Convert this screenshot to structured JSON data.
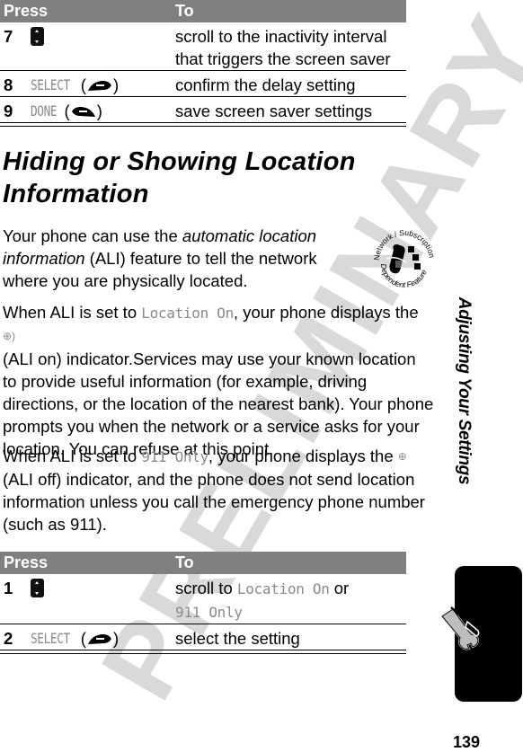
{
  "watermark": "PRELIMINARY",
  "table_top": {
    "header": {
      "press": "Press",
      "to": "To"
    },
    "rows": [
      {
        "step": "7",
        "key": "nav-key",
        "to_lines": [
          "scroll to the inactivity interval",
          "that triggers the screen saver"
        ]
      },
      {
        "step": "8",
        "softkey": "SELECT",
        "key": "right-soft-key",
        "to": "confirm the delay setting"
      },
      {
        "step": "9",
        "softkey": "DONE",
        "key": "left-soft-key",
        "to": "save screen saver settings"
      }
    ]
  },
  "heading": "Hiding or Showing Location Information",
  "intro": {
    "before": "Your phone can use the ",
    "italic": "automatic location information",
    "after": " (ALI) feature to tell the network where you are physically located."
  },
  "badge": {
    "top_text": "Network / Subscription",
    "bottom_text": "Dependent Feature",
    "icon": "network-subscription-dependent-feature-icon"
  },
  "para2": {
    "before": "When ALI is set to ",
    "term": "Location On",
    "after": ", your phone displays the ",
    "indicator": "⊕)",
    "rest": "(ALI on) indicator.Services may use your known location to provide useful information (for example, driving directions, or the location of the nearest bank). Your phone prompts you when the network or a service asks for your location. You can refuse at this point."
  },
  "para3": {
    "before": "When ALI is set to ",
    "term": "911 Only",
    "after": ", your phone displays the ",
    "indicator": "⊕",
    "rest": "(ALI off) indicator, and the phone does not send location information unless you call the emergency phone number (such as 911)."
  },
  "table_bottom": {
    "header": {
      "press": "Press",
      "to": "To"
    },
    "rows": [
      {
        "step": "1",
        "key": "nav-key",
        "to_prefix": "scroll to ",
        "term1": "Location On",
        "to_mid": " or",
        "term2": "911 Only"
      },
      {
        "step": "2",
        "softkey": "SELECT",
        "key": "right-soft-key",
        "to": "select the setting"
      }
    ]
  },
  "side_tab": {
    "title": "Adjusting Your Settings",
    "icon": "tools-icon"
  },
  "page_number": "139"
}
